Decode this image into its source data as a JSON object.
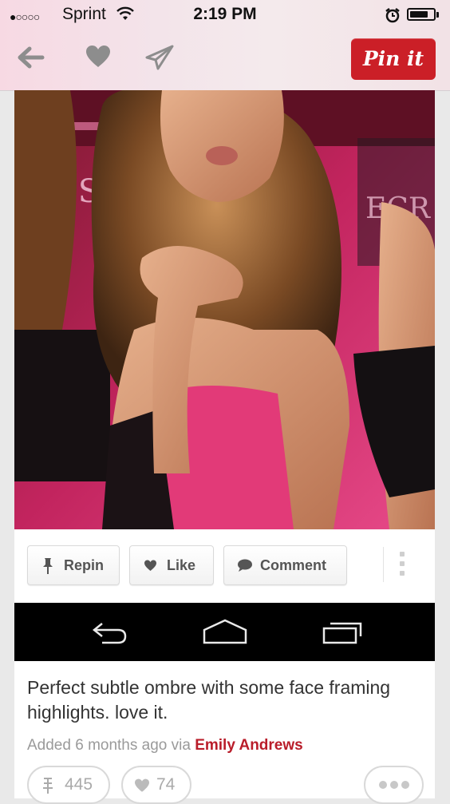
{
  "status_bar": {
    "signal": "●○○○○",
    "carrier": "Sprint",
    "time": "2:19 PM"
  },
  "nav": {
    "pin_it_label": "Pin it"
  },
  "pin": {
    "image_description_icon": "photo",
    "actions": {
      "repin_label": "Repin",
      "like_label": "Like",
      "comment_label": "Comment"
    },
    "description": "Perfect subtle ombre with some face framing highlights. love it.",
    "added_text": "Added 6 months ago via",
    "added_by": "Emily Andrews",
    "repin_count": "445",
    "like_count": "74"
  },
  "colors": {
    "pin_it_red": "#cb1f27",
    "username_red": "#b91d2a"
  },
  "icons": [
    "wifi-icon",
    "alarm-icon",
    "battery-icon",
    "back-arrow-icon",
    "heart-icon",
    "send-icon",
    "pushpin-icon",
    "speech-bubble-icon",
    "android-back-icon",
    "android-home-icon",
    "android-recents-icon",
    "more-icon"
  ]
}
